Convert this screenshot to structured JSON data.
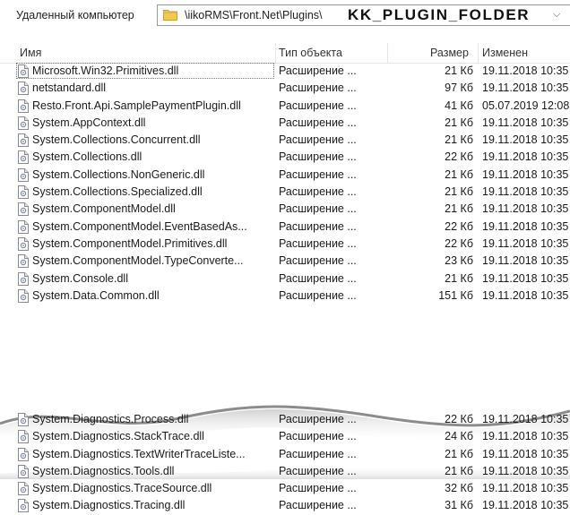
{
  "address": {
    "label": "Удаленный компьютер",
    "path": "\\iikoRMS\\Front.Net\\Plugins\\",
    "folder": "KK_PLUGIN_FOLDER",
    "dropdown_glyph": "⌵"
  },
  "columns": {
    "name": "Имя",
    "type": "Тип объекта",
    "size": "Размер",
    "modified": "Изменен"
  },
  "files_top": [
    {
      "name": "Microsoft.Win32.Primitives.dll",
      "type": "Расширение ...",
      "size": "21 Кб",
      "modified": "19.11.2018 10:35"
    },
    {
      "name": "netstandard.dll",
      "type": "Расширение ...",
      "size": "97 Кб",
      "modified": "19.11.2018 10:35"
    },
    {
      "name": "Resto.Front.Api.SamplePaymentPlugin.dll",
      "type": "Расширение ...",
      "size": "41 Кб",
      "modified": "05.07.2019 12:08"
    },
    {
      "name": "System.AppContext.dll",
      "type": "Расширение ...",
      "size": "21 Кб",
      "modified": "19.11.2018 10:35"
    },
    {
      "name": "System.Collections.Concurrent.dll",
      "type": "Расширение ...",
      "size": "21 Кб",
      "modified": "19.11.2018 10:35"
    },
    {
      "name": "System.Collections.dll",
      "type": "Расширение ...",
      "size": "22 Кб",
      "modified": "19.11.2018 10:35"
    },
    {
      "name": "System.Collections.NonGeneric.dll",
      "type": "Расширение ...",
      "size": "21 Кб",
      "modified": "19.11.2018 10:35"
    },
    {
      "name": "System.Collections.Specialized.dll",
      "type": "Расширение ...",
      "size": "21 Кб",
      "modified": "19.11.2018 10:35"
    },
    {
      "name": "System.ComponentModel.dll",
      "type": "Расширение ...",
      "size": "21 Кб",
      "modified": "19.11.2018 10:35"
    },
    {
      "name": "System.ComponentModel.EventBasedAs...",
      "type": "Расширение ...",
      "size": "22 Кб",
      "modified": "19.11.2018 10:35"
    },
    {
      "name": "System.ComponentModel.Primitives.dll",
      "type": "Расширение ...",
      "size": "22 Кб",
      "modified": "19.11.2018 10:35"
    },
    {
      "name": "System.ComponentModel.TypeConverte...",
      "type": "Расширение ...",
      "size": "23 Кб",
      "modified": "19.11.2018 10:35"
    },
    {
      "name": "System.Console.dll",
      "type": "Расширение ...",
      "size": "21 Кб",
      "modified": "19.11.2018 10:35"
    },
    {
      "name": "System.Data.Common.dll",
      "type": "Расширение ...",
      "size": "151 Кб",
      "modified": "19.11.2018 10:35"
    }
  ],
  "files_bottom": [
    {
      "name": "System.Diagnostics.Process.dll",
      "type": "Расширение ...",
      "size": "22 Кб",
      "modified": "19.11.2018 10:35"
    },
    {
      "name": "System.Diagnostics.StackTrace.dll",
      "type": "Расширение ...",
      "size": "24 Кб",
      "modified": "19.11.2018 10:35"
    },
    {
      "name": "System.Diagnostics.TextWriterTraceListe...",
      "type": "Расширение ...",
      "size": "21 Кб",
      "modified": "19.11.2018 10:35"
    },
    {
      "name": "System.Diagnostics.Tools.dll",
      "type": "Расширение ...",
      "size": "21 Кб",
      "modified": "19.11.2018 10:35"
    },
    {
      "name": "System.Diagnostics.TraceSource.dll",
      "type": "Расширение ...",
      "size": "32 Кб",
      "modified": "19.11.2018 10:35"
    },
    {
      "name": "System.Diagnostics.Tracing.dll",
      "type": "Расширение ...",
      "size": "31 Кб",
      "modified": "19.11.2018 10:35"
    }
  ],
  "selected_index": 0,
  "colors": {
    "folder": "#f2c94c",
    "border": "#9a9a9a",
    "header_sep": "#e5e5e5"
  }
}
